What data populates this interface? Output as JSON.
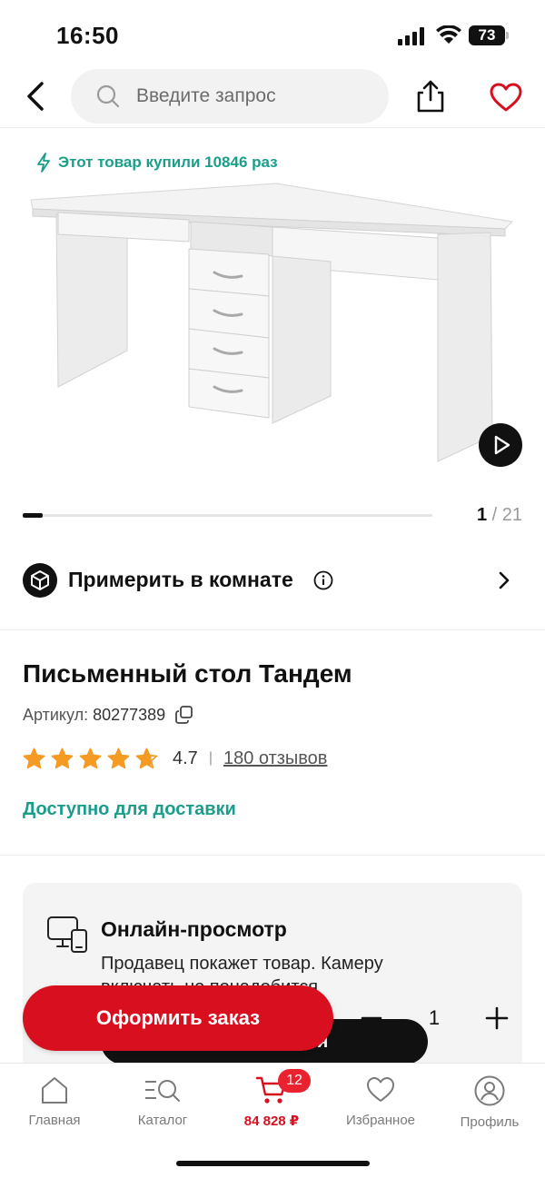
{
  "status_bar": {
    "time": "16:50",
    "battery": "73"
  },
  "nav": {
    "search_placeholder": "Введите запрос",
    "icons": [
      "back-arrow-icon",
      "search-icon",
      "share-icon",
      "heart-icon"
    ]
  },
  "gallery": {
    "bought_text": "Этот товар купили 10846 раз",
    "current": "1",
    "separator": " / ",
    "total": "21",
    "progress": 0.048
  },
  "try_in_room": {
    "label": "Примерить в комнате"
  },
  "product": {
    "title": "Письменный стол Тандем",
    "article_label": "Артикул: ",
    "article_value": "80277389",
    "rating": "4.7",
    "rating_value": 4.7,
    "reviews": "180 отзывов",
    "availability": "Доступно для доставки"
  },
  "online_view": {
    "title": "Онлайн-просмотр",
    "description": "Продавец покажет товар. Камеру включать не понадобится",
    "button_label": "Договориться"
  },
  "order_bar": {
    "order_button": "Оформить заказ",
    "quantity": "1"
  },
  "tab_bar": {
    "tabs": [
      {
        "label": "Главная",
        "icon": "home-icon"
      },
      {
        "label": "Каталог",
        "icon": "catalog-icon"
      },
      {
        "label": "84 828 ₽",
        "icon": "cart-icon",
        "badge": "12",
        "active": true
      },
      {
        "label": "Избранное",
        "icon": "heart-icon"
      },
      {
        "label": "Профиль",
        "icon": "profile-icon"
      }
    ]
  },
  "colors": {
    "accent_red": "#d80f1f",
    "accent_teal": "#1a9e8a",
    "star_orange": "#f59a23",
    "badge_red": "#e8232f"
  }
}
